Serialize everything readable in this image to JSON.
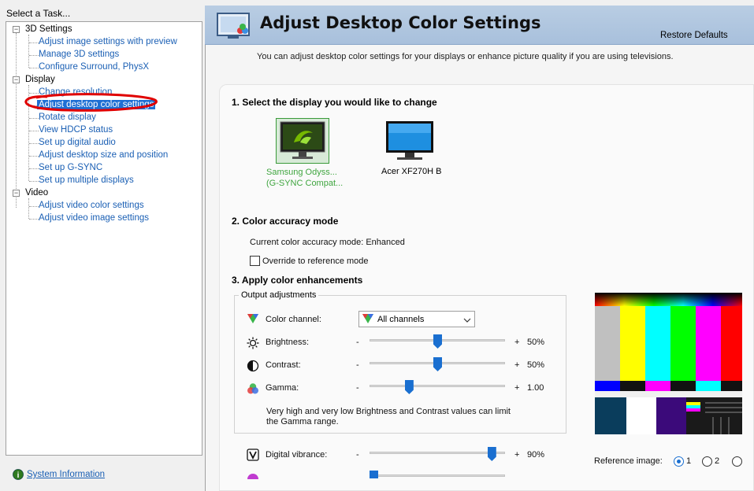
{
  "task_label": "Select a Task...",
  "tree": {
    "cat_3d": "3D Settings",
    "items_3d": [
      "Adjust image settings with preview",
      "Manage 3D settings",
      "Configure Surround, PhysX"
    ],
    "cat_display": "Display",
    "items_display": [
      "Change resolution",
      "Adjust desktop color settings",
      "Rotate display",
      "View HDCP status",
      "Set up digital audio",
      "Adjust desktop size and position",
      "Set up G-SYNC",
      "Set up multiple displays"
    ],
    "cat_video": "Video",
    "items_video": [
      "Adjust video color settings",
      "Adjust video image settings"
    ]
  },
  "system_info": "System Information",
  "header": {
    "title": "Adjust Desktop Color Settings",
    "restore": "Restore Defaults"
  },
  "description": "You can adjust desktop color settings for your displays or enhance picture quality if you are using televisions.",
  "section1": "1. Select the display you would like to change",
  "displays": [
    {
      "line1": "Samsung Odyss...",
      "line2": "(G-SYNC Compat..."
    },
    {
      "line1": "Acer XF270H B"
    }
  ],
  "section2": "2. Color accuracy mode",
  "current_mode": "Current color accuracy mode: Enhanced",
  "override": "Override to reference mode",
  "section3": "3. Apply color enhancements",
  "output_adjustments": "Output adjustments",
  "color_channel_label": "Color channel:",
  "color_channel_value": "All channels",
  "sliders": [
    {
      "label": "Brightness:",
      "minus": "-",
      "plus": "+",
      "value": "50%",
      "fraction": 0.5
    },
    {
      "label": "Contrast:",
      "minus": "-",
      "plus": "+",
      "value": "50%",
      "fraction": 0.5
    },
    {
      "label": "Gamma:",
      "minus": "-",
      "plus": "+",
      "value": "1.00",
      "fraction": 0.29
    },
    {
      "label": "Digital vibrance:",
      "minus": "-",
      "plus": "+",
      "value": "90%",
      "fraction": 0.9
    }
  ],
  "note": "Very high and very low Brightness and Contrast values can limit the Gamma range.",
  "reference_image": {
    "label": "Reference image:",
    "options": [
      "1",
      "2"
    ],
    "selected": "1"
  },
  "colors": {
    "link": "#1a5fb4",
    "accent": "#1e6fd4",
    "nvidia_green": "#3fa53f"
  }
}
